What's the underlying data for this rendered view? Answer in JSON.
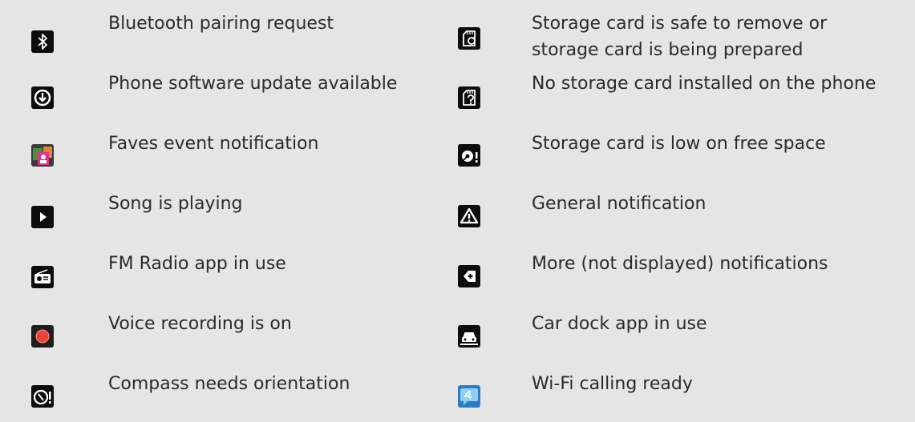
{
  "left_items": [
    {
      "icon": "bluetooth-icon",
      "label": "Bluetooth pairing request"
    },
    {
      "icon": "software-update-icon",
      "label": "Phone software update available"
    },
    {
      "icon": "faves-icon",
      "label": "Faves event notification"
    },
    {
      "icon": "play-icon",
      "label": "Song is playing"
    },
    {
      "icon": "radio-icon",
      "label": "FM Radio app in use"
    },
    {
      "icon": "recording-icon",
      "label": "Voice recording is on"
    },
    {
      "icon": "compass-icon",
      "label": "Compass needs orientation"
    }
  ],
  "right_items": [
    {
      "icon": "storage-card-prepare-icon",
      "label": "Storage card is safe to remove or\nstorage card is being prepared"
    },
    {
      "icon": "no-storage-card-icon",
      "label": "No storage card installed on the phone"
    },
    {
      "icon": "storage-low-icon",
      "label": "Storage card is low on free space"
    },
    {
      "icon": "warning-icon",
      "label": "General notification"
    },
    {
      "icon": "more-notifications-icon",
      "label": "More (not displayed) notifications"
    },
    {
      "icon": "car-dock-icon",
      "label": "Car dock app in use"
    },
    {
      "icon": "wifi-calling-icon",
      "label": "Wi-Fi calling ready"
    }
  ]
}
